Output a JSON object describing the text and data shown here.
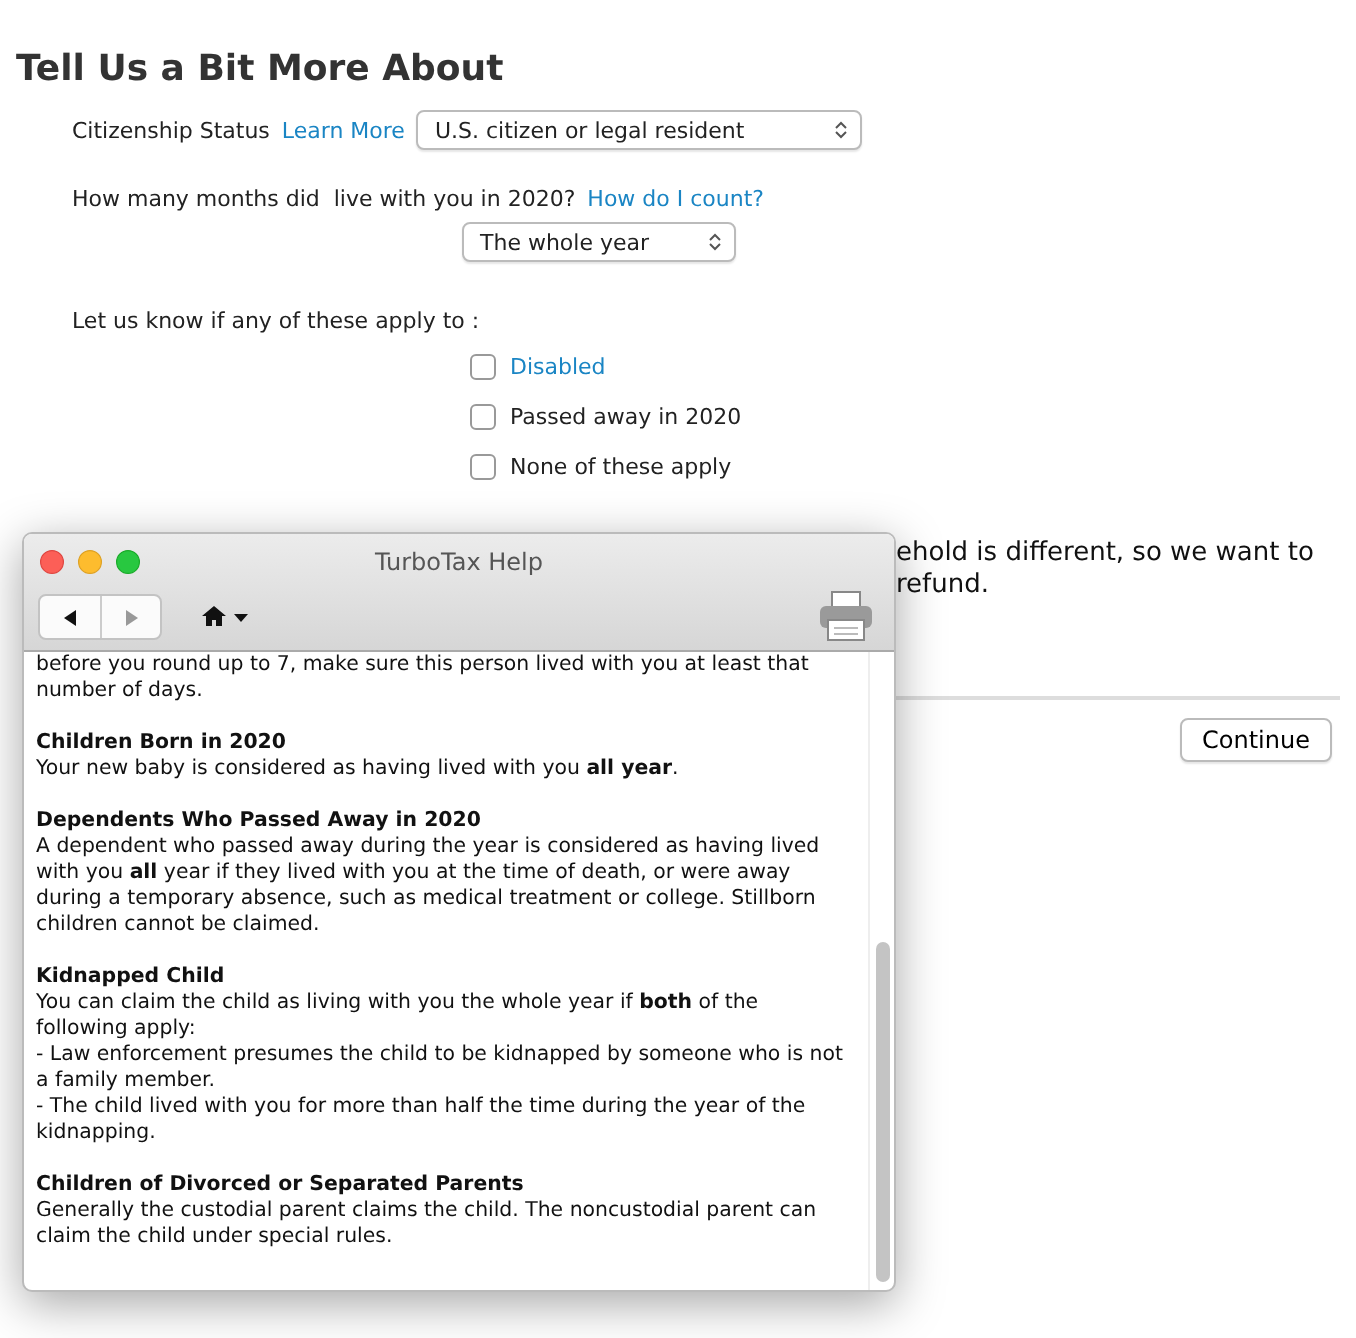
{
  "page": {
    "title": "Tell Us a Bit More About",
    "citizenship": {
      "label": "Citizenship Status",
      "link": "Learn More",
      "value": "U.S. citizen or legal resident"
    },
    "months": {
      "label": "How many months did  live with you in 2020?",
      "link": "How do I count?",
      "value": "The whole year"
    },
    "applies": {
      "label": "Let us know if any of these apply to :",
      "options": [
        {
          "label": "Disabled",
          "checked": false,
          "kind": "link"
        },
        {
          "label": "Passed away in 2020",
          "checked": false,
          "kind": "plain"
        },
        {
          "label": "None of these apply",
          "checked": false,
          "kind": "plain"
        }
      ]
    },
    "note_lines": [
      "ehold is different, so we want to",
      "refund."
    ],
    "continue_button": "Continue"
  },
  "help_window": {
    "title": "TurboTax Help",
    "intro": "before you round up to 7, make sure this person lived with you at least that number of days.",
    "sections": [
      {
        "heading": "Children Born in 2020",
        "lines": [
          "Your new baby is considered as having lived with you **all year**."
        ]
      },
      {
        "heading": "Dependents Who Passed Away in 2020",
        "lines": [
          "A dependent who passed away during the year is considered as having lived with you **all** year if they lived with you at the time of death, or were away during a temporary absence, such as medical treatment or college. Stillborn children cannot be claimed."
        ]
      },
      {
        "heading": "Kidnapped Child",
        "lines": [
          "You can claim the child as living with you the whole year if **both** of the following apply:",
          "- Law enforcement presumes the child to be kidnapped by someone who is not a family member.",
          "- The child lived with you for more than half the time during the year of the kidnapping."
        ]
      },
      {
        "heading": "Children of Divorced or Separated Parents",
        "lines": [
          "Generally the custodial parent claims the child. The noncustodial parent can claim the child under special rules."
        ]
      }
    ]
  }
}
